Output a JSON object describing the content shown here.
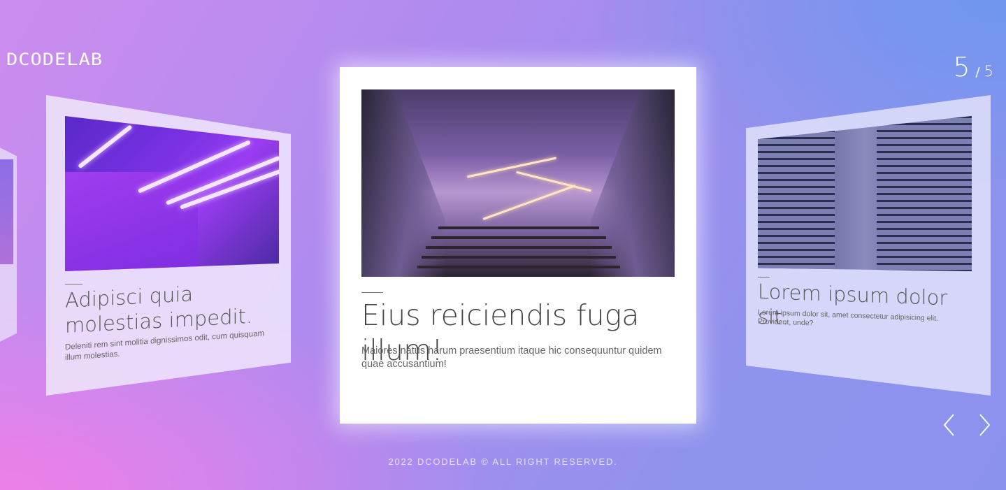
{
  "brand": {
    "logo": "DCODELAB"
  },
  "pagination": {
    "current": "5",
    "separator": "/",
    "total": "5"
  },
  "slides": {
    "left": {
      "title": "Adipisci quia molestias impedit.",
      "description": "Deleniti rem sint molitia dignissimos odit, cum quisquam illum molestias."
    },
    "center": {
      "title": "Eius reiciendis fuga illum!",
      "description": "Maiores natus harum praesentium itaque hic consequuntur quidem quae accusantium!"
    },
    "right": {
      "title": "Lorem ipsum dolor sit.",
      "description": "Lorem ipsum dolor sit, amet consectetur adipisicing elit. Provident, unde?"
    }
  },
  "navigation": {
    "prev_icon": "chevron-left-icon",
    "next_icon": "chevron-right-icon"
  },
  "footer": {
    "text": "2022 DCODELAB © ALL RIGHT RESERVED."
  },
  "colors": {
    "gradient_pink": "#ee7fe9",
    "gradient_purple": "#a98bef",
    "gradient_blue": "#6f96ee",
    "card_bg": "#ffffff"
  }
}
